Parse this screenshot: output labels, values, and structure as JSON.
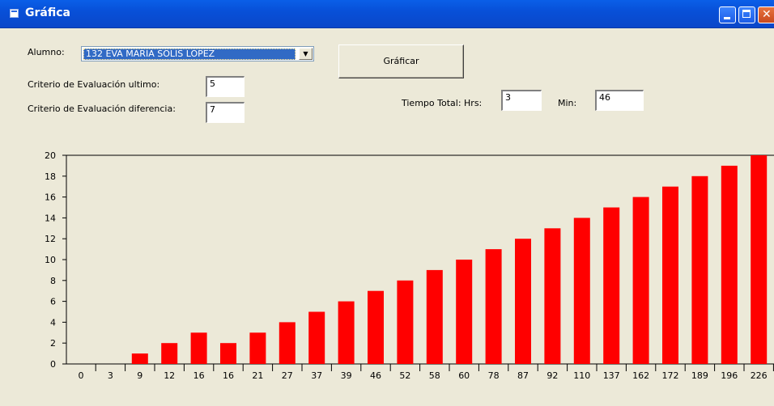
{
  "window": {
    "title": "Gráfica",
    "title_icon": "form-icon",
    "controls": [
      "minimize-icon",
      "maximize-icon",
      "close-icon"
    ]
  },
  "form": {
    "alumno_label": "Alumno:",
    "alumno_value": "132   EVA MARIA SOLIS LOPEZ",
    "graficar_label": "Gráficar",
    "criterio_ultimo_label": "Criterio de Evaluación ultimo:",
    "criterio_ultimo_value": "5",
    "criterio_diferencia_label": "Criterio de Evaluación diferencia:",
    "criterio_diferencia_value": "7",
    "tiempo_label": "Tiempo Total: Hrs:",
    "hrs_value": "3",
    "min_label": "Min:",
    "min_value": "46"
  },
  "chart_data": {
    "type": "bar",
    "categories": [
      "0",
      "3",
      "9",
      "12",
      "16",
      "16",
      "21",
      "27",
      "37",
      "39",
      "46",
      "52",
      "58",
      "60",
      "78",
      "87",
      "92",
      "110",
      "137",
      "162",
      "172",
      "189",
      "196",
      "226"
    ],
    "values": [
      0,
      0,
      1,
      2,
      3,
      2,
      3,
      4,
      5,
      6,
      7,
      8,
      9,
      10,
      11,
      12,
      13,
      14,
      15,
      16,
      17,
      18,
      19,
      20
    ],
    "yticks": [
      "0",
      "2",
      "4",
      "6",
      "8",
      "10",
      "12",
      "14",
      "16",
      "18",
      "20"
    ],
    "ylim": [
      0,
      20
    ],
    "bar_color": "#ff0000",
    "grid": false,
    "legend": "none"
  }
}
